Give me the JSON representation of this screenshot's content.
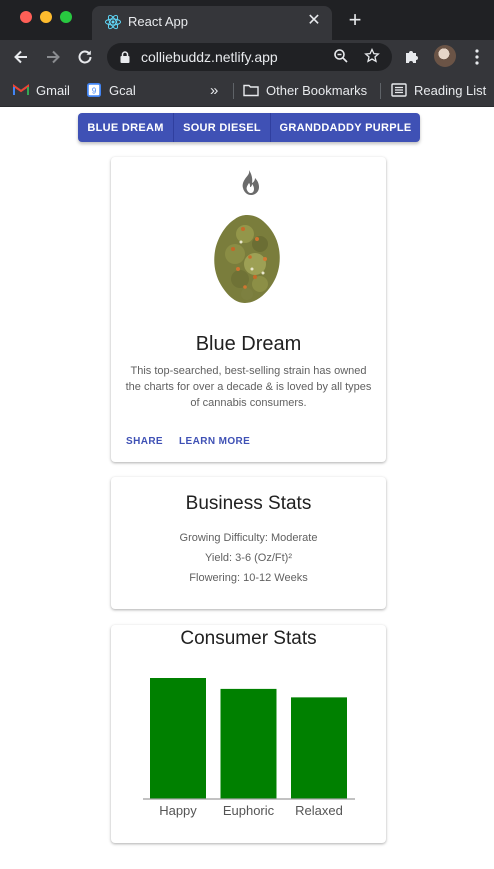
{
  "browser": {
    "tab_title": "React App",
    "tab_close": "✕",
    "new_tab": "+",
    "url": "colliebuddz.netlify.app",
    "bookmarks": [
      {
        "label": "Gmail",
        "icon": "gmail-icon"
      },
      {
        "label": "Gcal",
        "icon": "calendar-icon"
      },
      {
        "label": "»",
        "icon": "chevron-more-icon"
      },
      {
        "label": "Other Bookmarks",
        "icon": "folder-icon"
      },
      {
        "label": "Reading List",
        "icon": "reading-list-icon"
      }
    ]
  },
  "strains": {
    "buttons": [
      "BLUE DREAM",
      "SOUR DIESEL",
      "GRANDDADDY PURPLE"
    ]
  },
  "strain_card": {
    "name": "Blue Dream",
    "description": "This top-searched, best-selling strain has owned the charts for over a decade & is loved by all types of cannabis consumers.",
    "actions": [
      "SHARE",
      "LEARN MORE"
    ]
  },
  "business_stats": {
    "title": "Business Stats",
    "lines": [
      "Growing Difficulty: Moderate",
      "Yield: 3-6 (Oz/Ft)²",
      "Flowering: 10-12 Weeks"
    ]
  },
  "consumer_stats": {
    "title": "Consumer Stats"
  },
  "colors": {
    "primary": "#3f51b5",
    "bar": "#008000",
    "chrome_dark": "#202124",
    "chrome_light": "#35363a"
  },
  "chart_data": {
    "type": "bar",
    "categories": [
      "Happy",
      "Euphoric",
      "Relaxed"
    ],
    "values": [
      100,
      91,
      84
    ],
    "ylim": [
      0,
      100
    ],
    "title": "",
    "xlabel": "",
    "ylabel": "",
    "grid": false,
    "legend": "none"
  }
}
